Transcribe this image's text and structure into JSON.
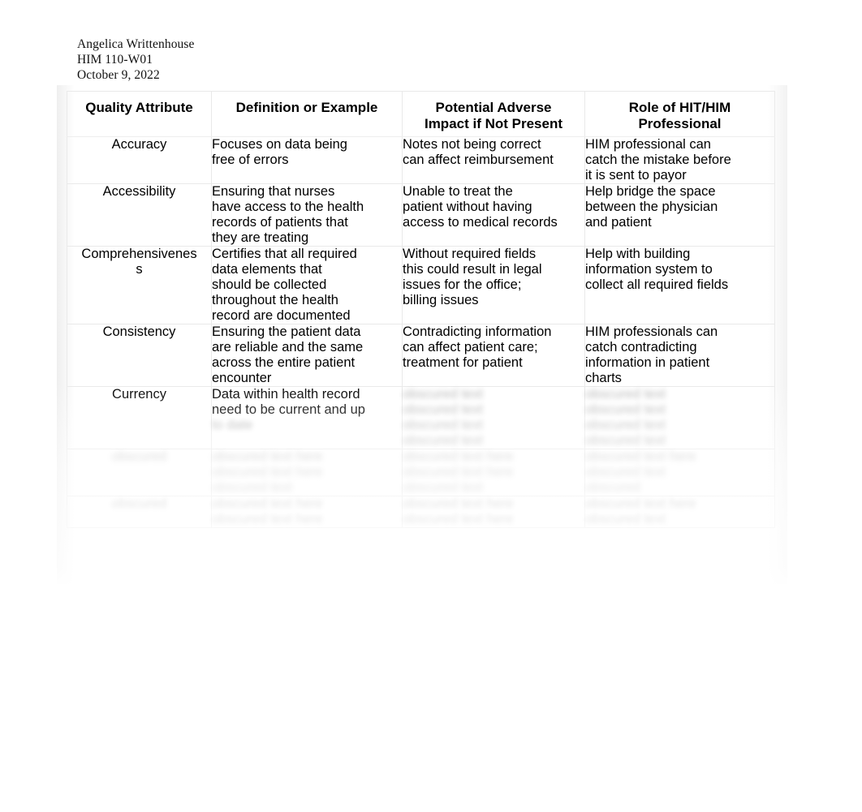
{
  "header": {
    "author": "Angelica Writtenhouse",
    "course": "HIM 110-W01",
    "date": "October 9, 2022"
  },
  "table": {
    "columns": [
      {
        "label": "Quality Attribute",
        "lines": [
          "Quality Attribute"
        ]
      },
      {
        "label": "Definition or Example",
        "lines": [
          "Definition or Example"
        ]
      },
      {
        "label": "Potential Adverse Impact if Not Present",
        "lines": [
          "Potential Adverse",
          "Impact if Not Present"
        ]
      },
      {
        "label": "Role of HIT/HIM Professional",
        "lines": [
          "Role of HIT/HIM",
          "Professional"
        ]
      }
    ],
    "rows": [
      {
        "attribute": "Accuracy",
        "attribute_lines": [
          "Accuracy"
        ],
        "definition": "Focuses on data being free of errors",
        "definition_lines": [
          "Focuses on data being",
          "free of errors"
        ],
        "impact": "Notes not being correct can affect reimbursement",
        "impact_lines": [
          "Notes not being correct",
          "can affect reimbursement"
        ],
        "role": "HIM professional can catch the mistake before it is sent to payor",
        "role_lines": [
          "HIM professional can",
          "catch the mistake before",
          "it is sent to payor"
        ]
      },
      {
        "attribute": "Accessibility",
        "attribute_lines": [
          "Accessibility"
        ],
        "definition": "Ensuring that nurses have access to the health records of patients that they are treating",
        "definition_lines": [
          "Ensuring that nurses",
          "have access to the health",
          "records of patients that",
          "they are treating"
        ],
        "impact": "Unable to treat the patient without having access to medical records",
        "impact_lines": [
          "Unable to treat the",
          "patient without having",
          "access to medical records"
        ],
        "role": "Help bridge the space between the physician and patient",
        "role_lines": [
          "Help bridge the space",
          "between the physician",
          "and patient"
        ]
      },
      {
        "attribute": "Comprehensiveness",
        "attribute_lines": [
          "Comprehensivenes",
          "s"
        ],
        "definition": "Certifies that all required data elements that should be collected throughout the health record are documented",
        "definition_lines": [
          "Certifies that all required",
          "data elements that",
          "should be collected",
          "throughout the health",
          "record are documented"
        ],
        "impact": "Without required fields this could result in legal issues for the office; billing issues",
        "impact_lines": [
          "Without required fields",
          "this could result in legal",
          "issues for the office;",
          "billing issues"
        ],
        "role": "Help with building information system to collect all required fields",
        "role_lines": [
          "Help with building",
          "information system to",
          "collect all required fields"
        ]
      },
      {
        "attribute": "Consistency",
        "attribute_lines": [
          "Consistency"
        ],
        "definition": "Ensuring the patient data are reliable and the same across the entire patient encounter",
        "definition_lines": [
          "Ensuring the patient data",
          "are reliable and the same",
          "across the entire patient",
          "encounter"
        ],
        "impact": "Contradicting information can affect patient care; treatment for patient",
        "impact_lines": [
          "Contradicting information",
          "can affect patient care;",
          "treatment for patient"
        ],
        "role": "HIM professionals can catch contradicting information in patient charts",
        "role_lines": [
          "HIM professionals can",
          "catch contradicting",
          "information in patient",
          "charts"
        ]
      },
      {
        "attribute": "Currency",
        "attribute_lines": [
          "Currency"
        ],
        "definition": "Data within health record need to be current and up to date",
        "definition_lines": [
          "Data within health record",
          "need to be current and up"
        ],
        "definition_obscured_lines": [
          "to date"
        ],
        "impact": "",
        "impact_lines": [],
        "impact_obscured_lines": [
          "obscured text",
          "obscured text",
          "obscured text",
          "obscured text"
        ],
        "role": "",
        "role_lines": [],
        "role_obscured_lines": [
          "obscured text",
          "obscured text",
          "obscured text",
          "obscured text"
        ]
      },
      {
        "attribute": "",
        "attribute_lines": [],
        "attribute_obscured_lines": [
          "obscured"
        ],
        "definition": "",
        "definition_lines": [],
        "definition_obscured_lines": [
          "obscured text here",
          "obscured text here",
          "obscured text"
        ],
        "impact": "",
        "impact_lines": [],
        "impact_obscured_lines": [
          "obscured text here",
          "obscured text here",
          "obscured text"
        ],
        "role": "",
        "role_lines": [],
        "role_obscured_lines": [
          "obscured text here",
          "obscured text",
          "obscured"
        ]
      },
      {
        "attribute": "",
        "attribute_lines": [],
        "attribute_obscured_lines": [
          "obscured"
        ],
        "definition": "",
        "definition_lines": [],
        "definition_obscured_lines": [
          "obscured text here",
          "obscured text here"
        ],
        "impact": "",
        "impact_lines": [],
        "impact_obscured_lines": [
          "obscured text here",
          "obscured text here"
        ],
        "role": "",
        "role_lines": [],
        "role_obscured_lines": [
          "obscured text here",
          "obscured text"
        ]
      }
    ]
  },
  "style": {
    "page_background": "#ffffff",
    "text_color": "#000000",
    "grid_color": "#e9e9e9"
  }
}
